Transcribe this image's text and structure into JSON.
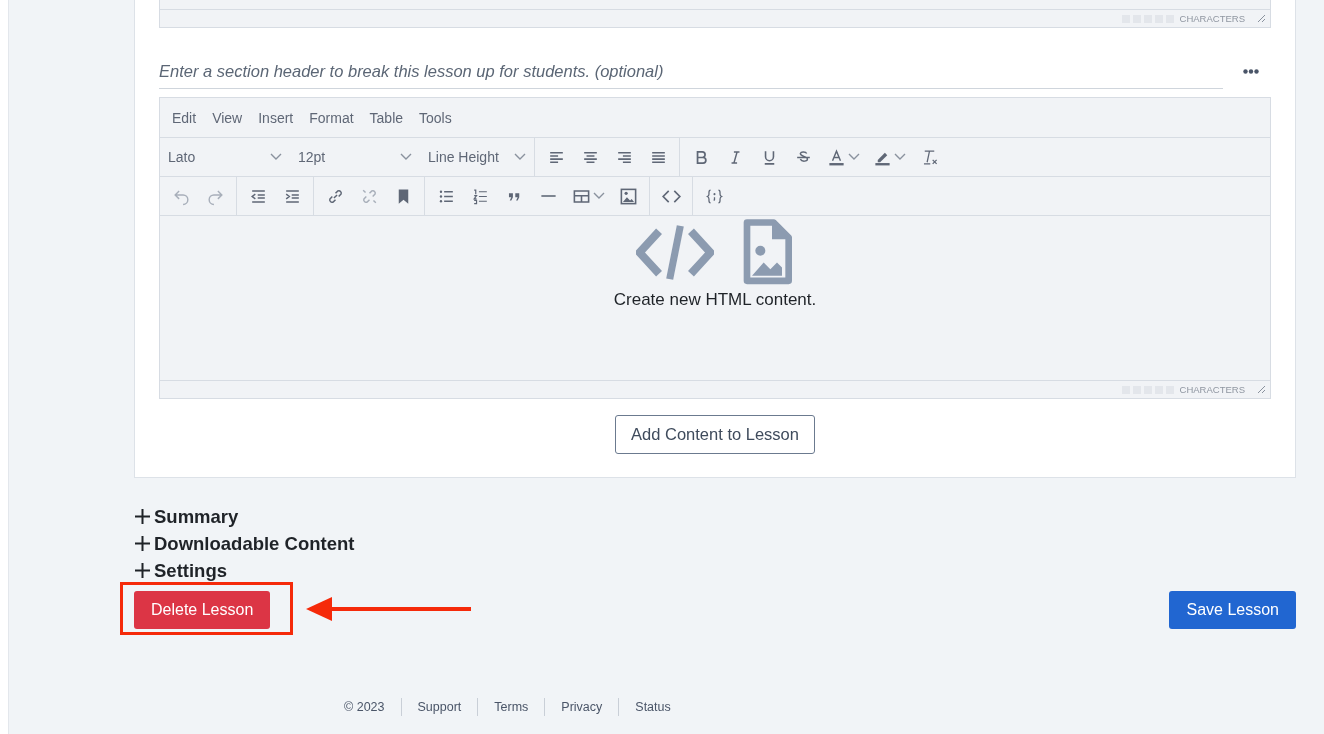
{
  "previous_editor": {
    "status": "CHARACTERS"
  },
  "section_header": {
    "placeholder": "Enter a section header to break this lesson up for students. (optional)"
  },
  "editor": {
    "menu": [
      "Edit",
      "View",
      "Insert",
      "Format",
      "Table",
      "Tools"
    ],
    "font": "Lato",
    "font_size": "12pt",
    "line_height": "Line Height",
    "empty_message": "Create new HTML content.",
    "status": "CHARACTERS"
  },
  "add_button": "Add Content to Lesson",
  "sections": [
    {
      "label": "Summary",
      "expanded": false
    },
    {
      "label": "Downloadable Content",
      "expanded": false
    },
    {
      "label": "Settings",
      "expanded": false
    }
  ],
  "delete_button": "Delete Lesson",
  "save_button": "Save Lesson",
  "footer": [
    "© 2023",
    "Support",
    "Terms",
    "Privacy",
    "Status"
  ]
}
